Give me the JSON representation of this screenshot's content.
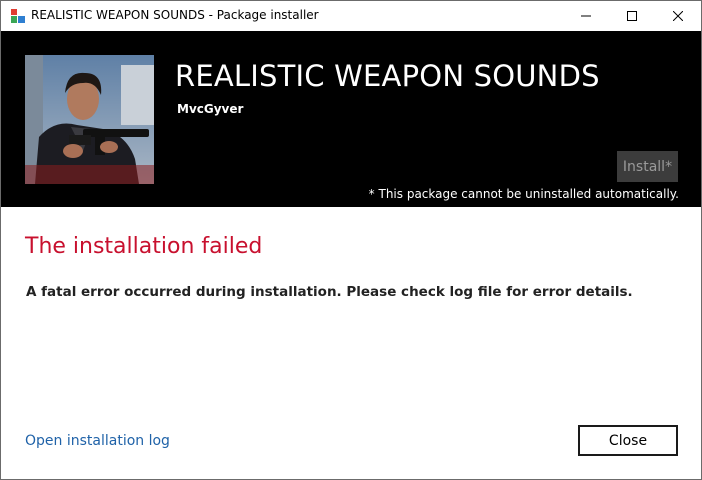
{
  "window": {
    "title": "REALISTIC WEAPON SOUNDS - Package installer",
    "controls": {
      "minimize_icon": "minimize-icon",
      "maximize_icon": "maximize-icon",
      "close_icon": "close-icon"
    }
  },
  "header": {
    "package_title": "REALISTIC WEAPON SOUNDS",
    "author": "MvcGyver",
    "install_label": "Install*",
    "note": "* This package cannot be uninstalled automatically.",
    "thumbnail_icon": "package-thumbnail-image"
  },
  "result": {
    "title": "The installation failed",
    "message": "A fatal error occurred during installation. Please check log file for error details."
  },
  "footer": {
    "log_link": "Open installation log",
    "close_label": "Close"
  },
  "colors": {
    "header_bg": "#000000",
    "error_title": "#c8102e",
    "link": "#1f62a8",
    "install_disabled_bg": "#3c3c3c"
  }
}
